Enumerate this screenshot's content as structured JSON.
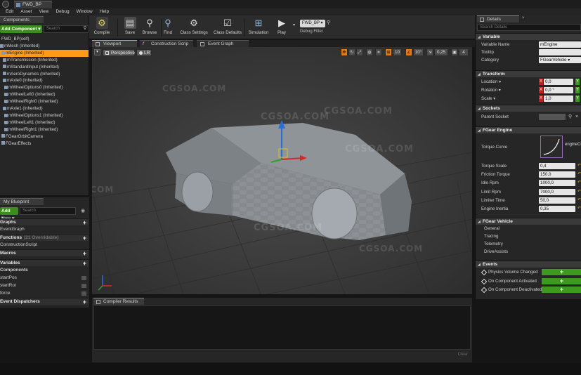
{
  "window": {
    "doc_tab": "FWD_BP"
  },
  "menu": [
    "Edit",
    "Asset",
    "View",
    "Debug",
    "Window",
    "Help"
  ],
  "components_panel": {
    "tab": "Components",
    "add_button": "Add Component ▾",
    "search_placeholder": "Search",
    "items": [
      "FWD_BP(self)",
      "mMesh (Inherited)",
      "mEngine (Inherited)",
      "mTransmission (Inherited)",
      "mStandardInput (Inherited)",
      "mAeroDynamics (Inherited)",
      "mAxle0 (Inherited)",
      "mWheelOptions0 (Inherited)",
      "mWheelLeft0 (Inherited)",
      "mWheelRight0 (Inherited)",
      "mAxle1 (Inherited)",
      "mWheelOptions1 (Inherited)",
      "mWheelLeft1 (Inherited)",
      "mWheelRight1 (Inherited)",
      "FGearOrbitCamera",
      "FGearEffects"
    ]
  },
  "blueprint_panel": {
    "tab": "My Blueprint",
    "add_button": "Add New ▾",
    "search_placeholder": "Search",
    "view_icon": "eye-icon",
    "graphs_label": "Graphs",
    "event_graph": "EventGraph",
    "functions_label": "Functions",
    "overridable": "(21 Overridable)",
    "construction_script": "ConstructionScript",
    "macros_label": "Macros",
    "variables_label": "Variables",
    "components_label": "Components",
    "variables": [
      "startPos",
      "startRot",
      "force"
    ],
    "dispatchers_label": "Event Dispatchers"
  },
  "toolbar": {
    "buttons": [
      {
        "label": "Compile",
        "icon": "compile-icon"
      },
      {
        "label": "Save",
        "icon": "save-icon"
      },
      {
        "label": "Browse",
        "icon": "browse-icon"
      },
      {
        "label": "Find",
        "icon": "find-icon"
      },
      {
        "label": "Class Settings",
        "icon": "class-settings-icon"
      },
      {
        "label": "Class Defaults",
        "icon": "class-defaults-icon"
      },
      {
        "label": "Simulation",
        "icon": "simulation-icon"
      },
      {
        "label": "Play",
        "icon": "play-icon"
      }
    ],
    "debug_object": "FWD_BP ▾",
    "debug_filter": "Debug Filter"
  },
  "center_tabs": [
    "Viewport",
    "Construction Scrip",
    "Event Graph"
  ],
  "viewport": {
    "perspective": "Perspective",
    "lit": "LR",
    "grid_snap": "10",
    "rot_snap": "10°",
    "scale_snap": "0,25",
    "camera_speed": "4",
    "watermark": "CGSOA.COM",
    "accent_color": "#e37a13"
  },
  "compiler": {
    "tab": "Compiler Results",
    "clear": "Clear"
  },
  "details": {
    "tab": "Details",
    "search_placeholder": "Search Details",
    "variable": {
      "title": "Variable",
      "name_label": "Variable Name",
      "name_value": "mEngine",
      "tooltip_label": "Tooltip",
      "category_label": "Category",
      "category_value": "FGearVehicle ▾"
    },
    "transform": {
      "title": "Transform",
      "location_label": "Location ▾",
      "location_x": "0,0",
      "rotation_label": "Rotation ▾",
      "rotation_x": "0,0 °",
      "scale_label": "Scale ▾",
      "scale_x": "1,0"
    },
    "sockets": {
      "title": "Sockets",
      "parent_label": "Parent Socket"
    },
    "engine": {
      "title": "FGear Engine",
      "torque_curve_label": "Torque Curve",
      "curve_name": "engineCu",
      "rows": [
        {
          "label": "Torque Scale",
          "value": "0,4"
        },
        {
          "label": "Friction Torque",
          "value": "150,0"
        },
        {
          "label": "Idle Rpm",
          "value": "1000,0"
        },
        {
          "label": "Limit Rpm",
          "value": "7000,0"
        },
        {
          "label": "Limiter Time",
          "value": "50,0"
        },
        {
          "label": "Engine Inertia",
          "value": "0,35"
        }
      ]
    },
    "vehicle": {
      "title": "FGear Vehicle",
      "items": [
        "General",
        "Tracing",
        "Telemetry",
        "DriveAssists"
      ]
    },
    "events": {
      "title": "Events",
      "items": [
        "Physics Volume Changed",
        "On Component Activated",
        "On Component Deactivated"
      ],
      "add_label": "+"
    }
  }
}
